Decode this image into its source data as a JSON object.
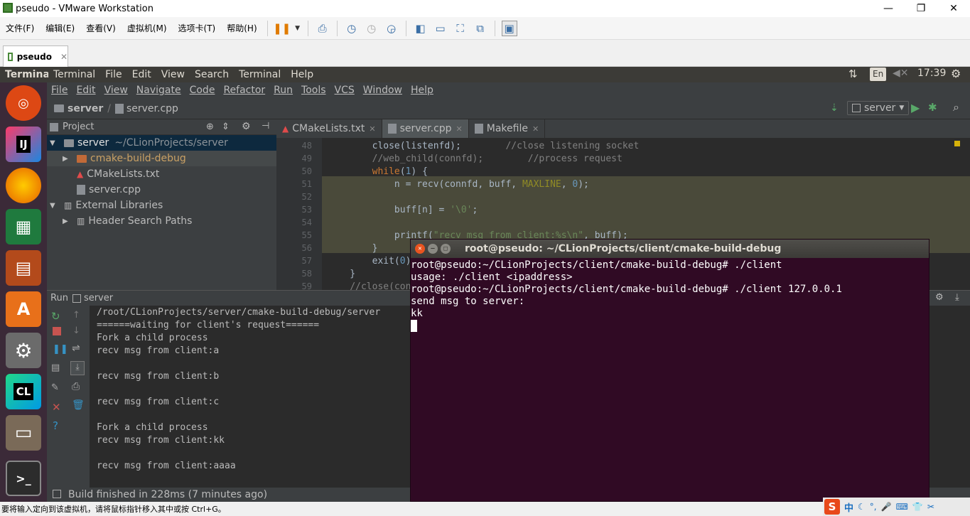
{
  "vmware": {
    "title": "pseudo - VMware Workstation",
    "window_controls": [
      "—",
      "❐",
      "✕"
    ],
    "menu": [
      "文件(F)",
      "编辑(E)",
      "查看(V)",
      "虚拟机(M)",
      "选项卡(T)",
      "帮助(H)"
    ],
    "tab": "pseudo",
    "status": "要将输入定向到该虚拟机，请将鼠标指针移入其中或按 Ctrl+G。"
  },
  "ubuntu": {
    "app_name": "Terminal",
    "menu": [
      "Terminal",
      "File",
      "Edit",
      "View",
      "Search",
      "Terminal",
      "Help"
    ],
    "lang": "En",
    "clock": "17:39"
  },
  "launcher": [
    {
      "name": "ubuntu-dash-icon",
      "color": "#dd4814",
      "glyph": "◎"
    },
    {
      "name": "intellij-icon",
      "color": "#1e1e3c",
      "glyph": "IJ"
    },
    {
      "name": "firefox-icon",
      "color": "#e66000",
      "glyph": "🦊"
    },
    {
      "name": "libreoffice-calc-icon",
      "color": "#1f7a3e",
      "glyph": "▦"
    },
    {
      "name": "libreoffice-impress-icon",
      "color": "#b34a1b",
      "glyph": "▤"
    },
    {
      "name": "software-center-icon",
      "color": "#e8701a",
      "glyph": "A"
    },
    {
      "name": "system-settings-icon",
      "color": "#6b6b6b",
      "glyph": "⚙"
    },
    {
      "name": "clion-icon",
      "color": "#1ca98f",
      "glyph": "CL"
    },
    {
      "name": "file-manager-icon",
      "color": "#7a6a58",
      "glyph": "▭"
    },
    {
      "name": "terminal-icon",
      "color": "#2c2c2c",
      "glyph": ">_"
    }
  ],
  "clion": {
    "menu": [
      "File",
      "Edit",
      "View",
      "Navigate",
      "Code",
      "Refactor",
      "Run",
      "Tools",
      "VCS",
      "Window",
      "Help"
    ],
    "breadcrumb": [
      "server",
      "server.cpp"
    ],
    "run_config": "server",
    "project_panel_title": "Project",
    "tree": [
      {
        "label": "server",
        "extra": "~/CLionProjects/server",
        "indent": 0,
        "arrow": "▼",
        "type": "folder",
        "selected": true
      },
      {
        "label": "cmake-build-debug",
        "extra": "",
        "indent": 1,
        "arrow": "▶",
        "type": "folder-orange",
        "selected": false
      },
      {
        "label": "CMakeLists.txt",
        "extra": "",
        "indent": 1,
        "arrow": "",
        "type": "cmake",
        "selected": false
      },
      {
        "label": "server.cpp",
        "extra": "",
        "indent": 1,
        "arrow": "",
        "type": "cpp",
        "selected": false
      },
      {
        "label": "External Libraries",
        "extra": "",
        "indent": 0,
        "arrow": "▼",
        "type": "lib",
        "selected": false
      },
      {
        "label": "Header Search Paths",
        "extra": "",
        "indent": 1,
        "arrow": "▶",
        "type": "lib",
        "selected": false
      }
    ],
    "editor_tabs": [
      {
        "label": "CMakeLists.txt",
        "active": false
      },
      {
        "label": "server.cpp",
        "active": true
      },
      {
        "label": "Makefile",
        "active": false
      }
    ],
    "code_lines": [
      {
        "n": "48",
        "html": "        close(listenfd);        <span class='cm'>//close listening socket</span>"
      },
      {
        "n": "49",
        "html": "        <span class='cm'>//web_child(connfd);        //process request</span>"
      },
      {
        "n": "50",
        "html": "        <span class='kw'>while</span>(<span class='num'>1</span>) {"
      },
      {
        "n": "51",
        "html": "            n = recv(connfd, buff, <span class='mac'>MAXLINE</span>, <span class='num'>0</span>);"
      },
      {
        "n": "52",
        "html": ""
      },
      {
        "n": "53",
        "html": "            buff[n] = <span class='st'>'\\0'</span>;"
      },
      {
        "n": "54",
        "html": ""
      },
      {
        "n": "55",
        "html": "            printf(<span class='st'>\"recv msg from client:%s\\n\"</span>, buff);"
      },
      {
        "n": "56",
        "html": "        }"
      },
      {
        "n": "57",
        "html": "        exit(<span class='num'>0</span>);"
      },
      {
        "n": "58",
        "html": "    }"
      },
      {
        "n": "59",
        "html": "    <span class='cm'>//close(con</span>"
      }
    ],
    "run_title": "Run",
    "run_config_label": "server",
    "run_output": [
      "/root/CLionProjects/server/cmake-build-debug/server",
      "======waiting for client's request======",
      "Fork a child process",
      "recv msg from client:a",
      "",
      "recv msg from client:b",
      "",
      "recv msg from client:c",
      "",
      "Fork a child process",
      "recv msg from client:kk",
      "",
      "recv msg from client:aaaa"
    ],
    "status": "Build finished in 228ms (7 minutes ago)"
  },
  "terminal": {
    "title": "root@pseudo: ~/CLionProjects/client/cmake-build-debug",
    "lines": [
      "root@pseudo:~/CLionProjects/client/cmake-build-debug# ./client",
      "usage: ./client <ipaddress>",
      "root@pseudo:~/CLionProjects/client/cmake-build-debug# ./client 127.0.0.1",
      "send msg to server:",
      "kk"
    ]
  },
  "tray": {
    "ime": "S",
    "ime_mode": "中"
  }
}
